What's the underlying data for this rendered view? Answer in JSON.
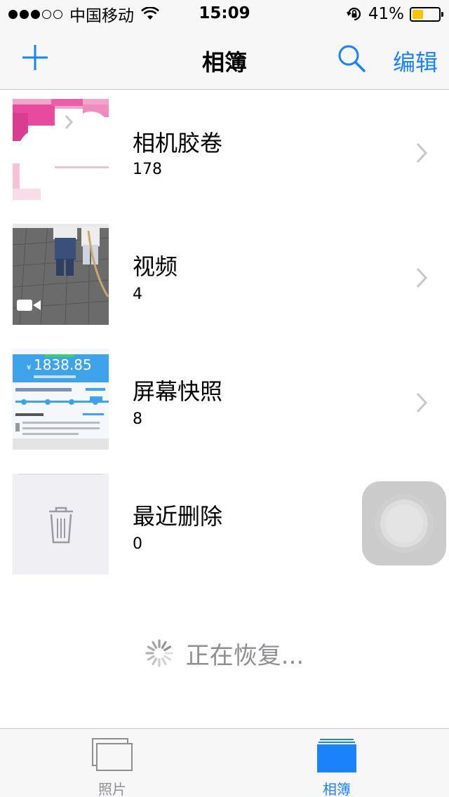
{
  "status_bar": {
    "carrier": "中国移动",
    "time": "15:09",
    "battery": "41%",
    "battery_level": 0.41,
    "signal_bars": 3
  },
  "nav": {
    "title": "相簿",
    "edit_label": "编辑"
  },
  "albums": [
    {
      "name": "相机胶卷",
      "count": "178",
      "icon": "camera-roll-thumbnail"
    },
    {
      "name": "视频",
      "count": "4",
      "icon": "video-camera-icon"
    },
    {
      "name": "屏幕快照",
      "count": "8",
      "icon": "screenshot-thumbnail"
    },
    {
      "name": "最近删除",
      "count": "0",
      "icon": "trash-icon"
    }
  ],
  "restore": {
    "text": "正在恢复..."
  },
  "screenshot_thumb": {
    "amount": "1838.85",
    "currency": "¥"
  },
  "tabs": [
    {
      "label": "照片",
      "icon": "photos-icon",
      "active": false
    },
    {
      "label": "相簿",
      "icon": "albums-icon",
      "active": true
    }
  ],
  "colors": {
    "accent": "#1a82fb",
    "secondary_text": "#8e8e93",
    "battery_fill": "#f7c600"
  }
}
